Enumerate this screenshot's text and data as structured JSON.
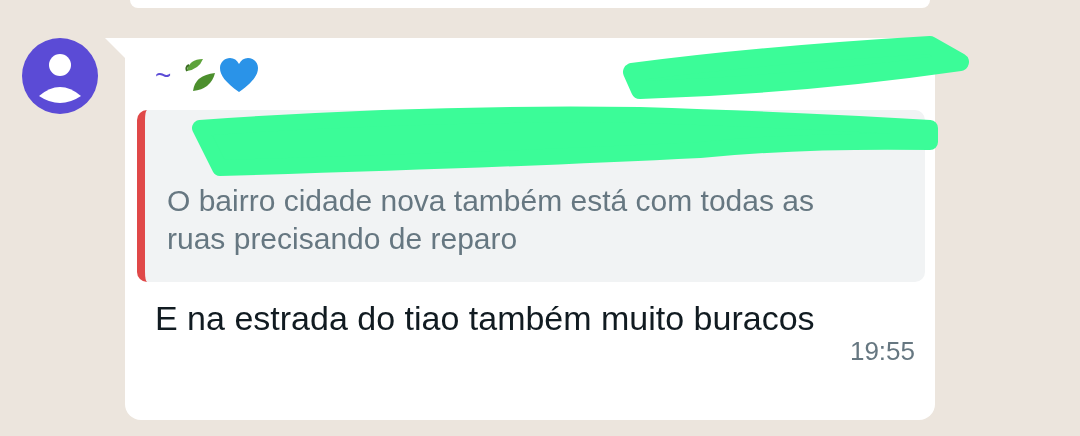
{
  "message": {
    "sender": {
      "prefix": "~"
    },
    "quote": {
      "text": "O bairro cidade nova também está com todas as ruas precisando de reparo"
    },
    "text": "E na estrada do tiao também muito buracos",
    "time": "19:55"
  }
}
